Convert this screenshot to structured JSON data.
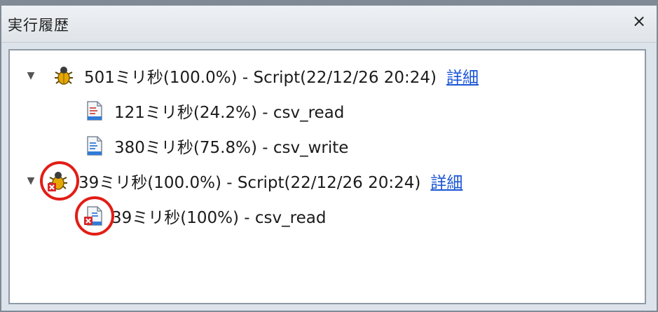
{
  "window": {
    "title": "実行履歴",
    "close_glyph": "×"
  },
  "tree": {
    "node1": {
      "text": "501ミリ秒(100.0%) - Script(22/12/26 20:24)",
      "link": "詳細",
      "icon": "bug-icon",
      "children": [
        {
          "text": "121ミリ秒(24.2%) - csv_read",
          "icon": "script-file-icon"
        },
        {
          "text": "380ミリ秒(75.8%) - csv_write",
          "icon": "script-file-icon"
        }
      ]
    },
    "node2": {
      "text": "39ミリ秒(100.0%) - Script(22/12/26 20:24)",
      "link": "詳細",
      "icon": "bug-error-icon",
      "children": [
        {
          "text": "39ミリ秒(100%) - csv_read",
          "icon": "script-file-error-icon"
        }
      ]
    }
  },
  "colors": {
    "link": "#1a56d6",
    "highlight_ring": "#e21d16",
    "error_badge": "#d8262a"
  }
}
